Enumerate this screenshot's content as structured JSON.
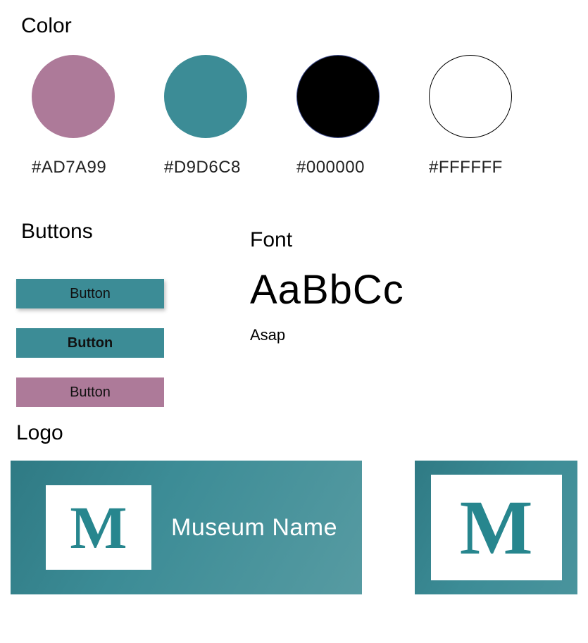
{
  "headings": {
    "color": "Color",
    "buttons": "Buttons",
    "font": "Font",
    "logo": "Logo"
  },
  "colors": {
    "swatches": [
      {
        "label": "#AD7A99",
        "value": "#AD7A99"
      },
      {
        "label": "#D9D6C8",
        "value": "#D9D6C8"
      },
      {
        "label": "#000000",
        "value": "#000000"
      },
      {
        "label": "#FFFFFF",
        "value": "#FFFFFF"
      }
    ]
  },
  "buttons": {
    "normal": "Button",
    "active": "Button",
    "alt": "Button"
  },
  "font": {
    "sample": "AaBbCc",
    "name": "Asap"
  },
  "logo": {
    "mark": "M",
    "wordmark": "Museum Name"
  }
}
